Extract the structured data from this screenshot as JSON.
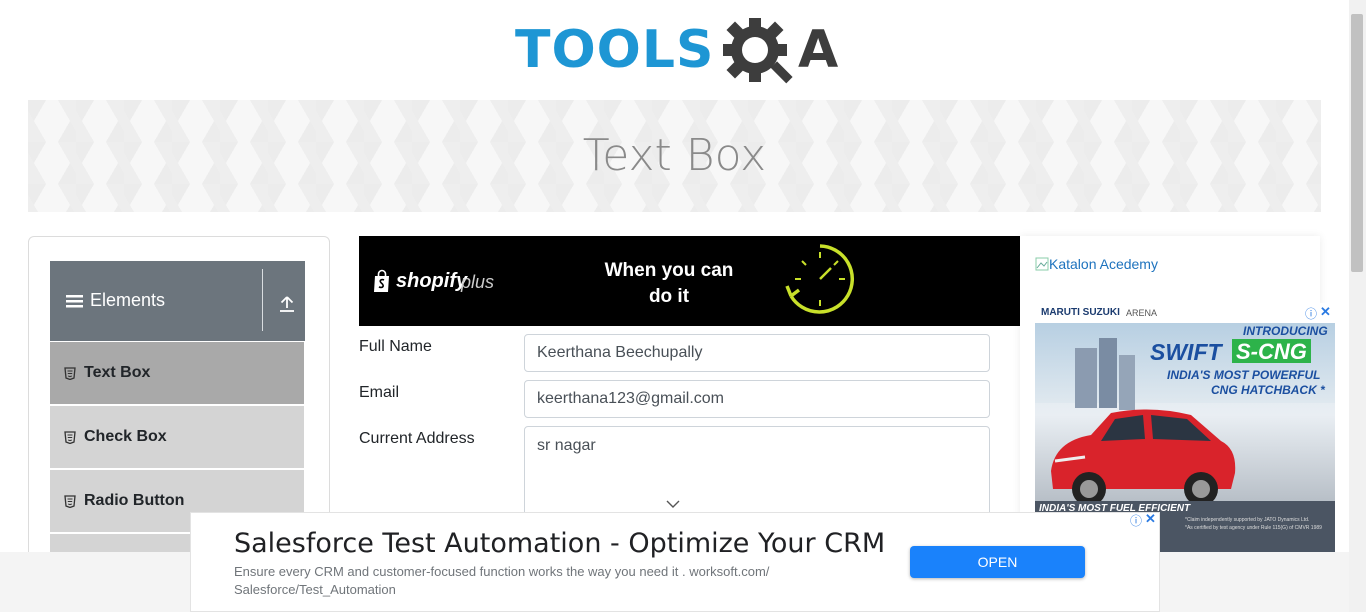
{
  "logo": {
    "part1": "TOOLS",
    "part2": "A"
  },
  "header": {
    "title": "Text Box"
  },
  "sidebar": {
    "group_title": "Elements",
    "items": [
      {
        "label": "Text Box"
      },
      {
        "label": "Check Box"
      },
      {
        "label": "Radio Button"
      }
    ]
  },
  "top_ad": {
    "brand": "shopify",
    "brand_suffix": "plus",
    "headline_line1": "When you can",
    "headline_line2": "do it"
  },
  "form": {
    "full_name_label": "Full Name",
    "full_name_value": "Keerthana Beechupally",
    "email_label": "Email",
    "email_value": "keerthana123@gmail.com",
    "address_label": "Current Address",
    "address_value": "sr nagar"
  },
  "right_column": {
    "katalon_alt": "Katalon Acedemy",
    "car_ad": {
      "brand": "MARUTI SUZUKI",
      "brand_suffix": "ARENA",
      "introducing": "INTRODUCING",
      "model_a": "SWIFT",
      "model_b": "S-CNG",
      "tagline_line1": "INDIA'S MOST POWERFUL",
      "tagline_line2": "CNG HATCHBACK *",
      "footer": "INDIA'S MOST FUEL EFFICIENT",
      "fine_print_1": "*Claim independently supported by JATO Dynamics Ltd.",
      "fine_print_2": "*As certified by test agency under Rule 115(G) of CMVR 1989"
    }
  },
  "bottom_ad": {
    "title": "Salesforce Test Automation - Optimize Your CRM",
    "description_line1": "Ensure every CRM and customer-focused function works the way you need it . worksoft.com/",
    "description_line2": "Salesforce/Test_Automation",
    "button": "OPEN"
  },
  "colors": {
    "brand_blue": "#1e96d4",
    "brand_dark": "#3d3d3d",
    "sidebar_header": "#6c757d",
    "active_item": "#a9a9a9",
    "open_button": "#1a82fb"
  }
}
